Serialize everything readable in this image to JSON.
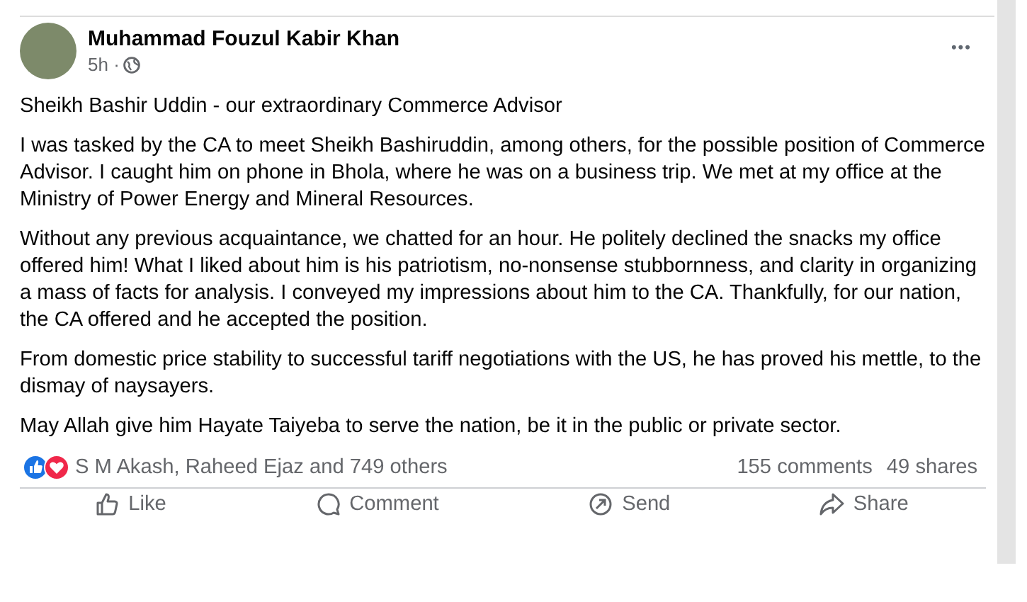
{
  "post": {
    "author": "Muhammad Fouzul Kabir Khan",
    "time": "5h ·",
    "more": "•••",
    "paragraphs": [
      "Sheikh Bashir Uddin - our extraordinary Commerce Advisor",
      "I was tasked by the CA to meet Sheikh Bashiruddin, among others, for the possible position of Commerce Advisor. I caught him on phone in Bhola, where he was on a business trip. We met at my office at the Ministry of Power Energy and Mineral Resources.",
      "Without any previous acquaintance, we chatted for an hour. He politely declined the snacks my office offered him! What I liked about him is his patriotism, no-nonsense stubbornness, and clarity in organizing a mass of facts for analysis. I conveyed my impressions about him to the CA. Thankfully, for our nation, the CA offered and he accepted the position.",
      "From domestic price stability to successful tariff negotiations with the US, he has proved his mettle, to the dismay of naysayers.",
      "May Allah give him Hayate Taiyeba to serve the nation, be it in the public or private sector."
    ],
    "reactions": [
      {
        "kind": "like"
      },
      {
        "kind": "love"
      }
    ],
    "reaction_summary": "S M Akash, Raheed Ejaz and 749 others",
    "comments": "155 comments",
    "shares": "49 shares",
    "actions": [
      {
        "kind": "like",
        "label": "Like"
      },
      {
        "kind": "comment",
        "label": "Comment"
      },
      {
        "kind": "send",
        "label": "Send"
      },
      {
        "kind": "share",
        "label": "Share"
      }
    ]
  }
}
